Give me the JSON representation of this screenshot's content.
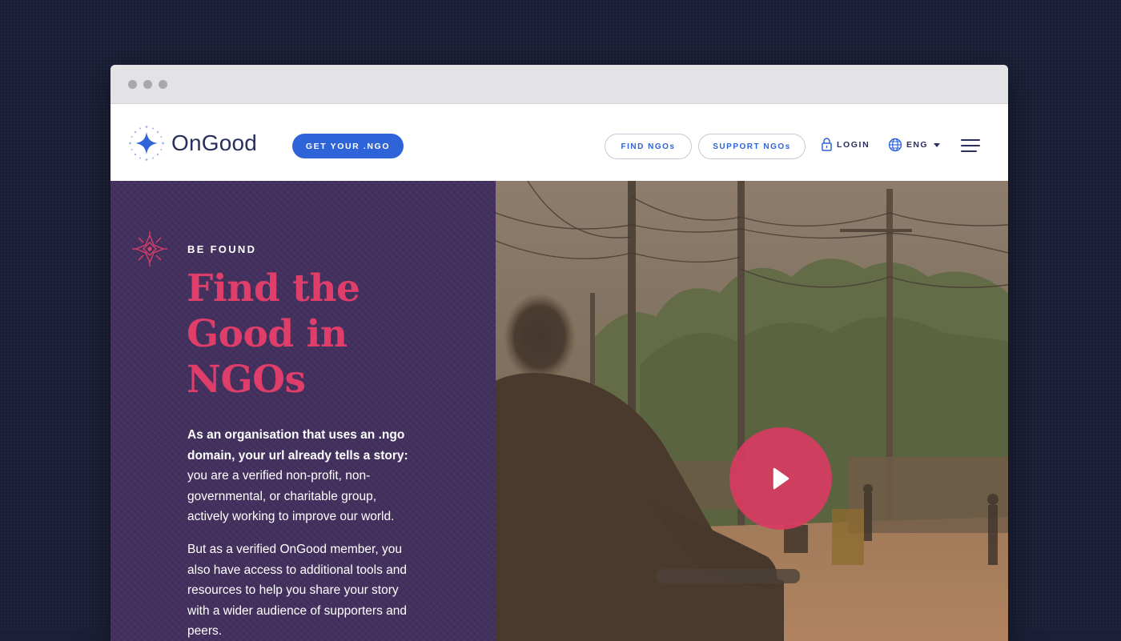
{
  "browser": {
    "dots": 3
  },
  "header": {
    "logo_text": "OnGood",
    "cta_label": "GET YOUR .NGO",
    "nav": {
      "find_label": "FIND NGOs",
      "support_label": "SUPPORT NGOs",
      "login_label": "LOGIN",
      "language_label": "ENG"
    },
    "icons": [
      "sparkle-logo-icon",
      "lock-icon",
      "globe-icon",
      "chevron-down-icon",
      "hamburger-menu-icon"
    ]
  },
  "hero": {
    "eyebrow": "BE FOUND",
    "headline": "Find the Good in NGOs",
    "paragraph1_bold": "As an organisation that uses an .ngo domain, your url already tells a story:",
    "paragraph1_rest": " you are a verified non-profit, non-governmental, or charitable group, actively working to improve our world.",
    "paragraph2": "But as a verified OnGood member, you also have access to additional tools and resources to help you share your story with a wider audience of supporters and peers.",
    "icons": [
      "compass-icon",
      "play-icon"
    ]
  },
  "colors": {
    "page_background": "#1b2038",
    "brand_blue": "#2f63d8",
    "brand_navy": "#2a2f5c",
    "hero_purple": "#43305e",
    "accent_pink": "#e03e6a"
  }
}
